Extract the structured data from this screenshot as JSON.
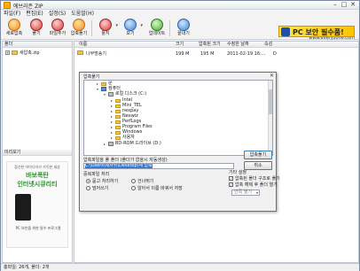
{
  "window": {
    "title": "에브리존 ZIP"
  },
  "menu": [
    "파일(F)",
    "편집(E)",
    "설정(S)",
    "도움말(H)"
  ],
  "toolbar": {
    "buttons": [
      {
        "label": "새로압축"
      },
      {
        "label": "풀기"
      },
      {
        "label": "파일추가"
      },
      {
        "label": "압축풀기"
      },
      {
        "label": "툴지"
      },
      {
        "label": "보기"
      },
      {
        "label": "업데이트"
      },
      {
        "label": "끝내기"
      }
    ],
    "url": "www.everyzone.com",
    "banner": "PC 보안 필수품!"
  },
  "left_panel": {
    "header": "폴더",
    "root": "새압축.zip",
    "preview_header": "미리보기",
    "ad": {
      "line1": "참신한 아이디어가 가득한 세상",
      "line2": "바보폭탄",
      "line3": "인터넷시큐리티",
      "line4": "PC 보안을 위한 필수 프로그램"
    }
  },
  "file_list": {
    "columns": [
      "이름",
      "크기",
      "압축된 크기",
      "수정한 날짜",
      "속성"
    ],
    "rows": [
      {
        "name": "나무방송기",
        "size": "199 M",
        "packed": "195 M",
        "date": "2011-02-19 16:...",
        "attr": "D"
      }
    ]
  },
  "dialog": {
    "title": "압축풀기",
    "tree": [
      {
        "label": "문"
      },
      {
        "label": "컴퓨터"
      },
      {
        "label": "로컬 디스크 (C:)"
      },
      {
        "label": "Intel"
      },
      {
        "label": "Mini_TEL"
      },
      {
        "label": "nexpay"
      },
      {
        "label": "Nexwiz"
      },
      {
        "label": "PerfLogs"
      },
      {
        "label": "Program Files"
      },
      {
        "label": "Windows"
      },
      {
        "label": "사용자"
      },
      {
        "label": "BD-ROM 드라이브 (D:)"
      }
    ],
    "folder_label": "압축파일을 풀 폴더 (폴더가 없을시 자동생성)",
    "path_value": "C:\\Users\\세차밖\\Desktop\\새 압축",
    "dup_label": "중복파일 처리",
    "radios": [
      {
        "label": "묻고 처리하기",
        "checked": true
      },
      {
        "label": "건너뛰기",
        "checked": false
      },
      {
        "label": "덮어쓰기",
        "checked": false
      },
      {
        "label": "알아서 이름 바꿔서 저장",
        "checked": false
      }
    ],
    "etc_label": "기타 설정",
    "checkboxes": [
      {
        "label": "압축된 폴더 구조로 풀기",
        "checked": true
      },
      {
        "label": "압축 해제 후 폴더 열기",
        "checked": true
      }
    ],
    "select_value": "안쪽 열기",
    "ok_label": "압축풀기",
    "cancel_label": "취소"
  },
  "status": "총파일: 26개, 폴더: 2개"
}
